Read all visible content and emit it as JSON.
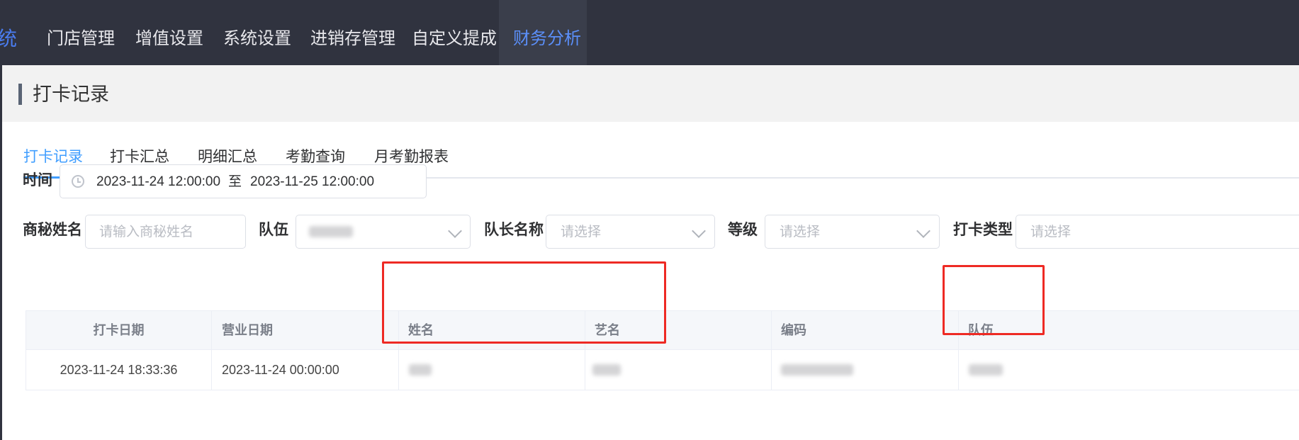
{
  "nav": {
    "brand_partial": "统",
    "items": [
      {
        "label": "门店管理"
      },
      {
        "label": "增值设置"
      },
      {
        "label": "系统设置"
      },
      {
        "label": "进销存管理"
      },
      {
        "label": "自定义提成"
      },
      {
        "label": "财务分析"
      }
    ],
    "active_index": 5
  },
  "page": {
    "title": "打卡记录"
  },
  "tabs": [
    {
      "label": "打卡记录"
    },
    {
      "label": "打卡汇总"
    },
    {
      "label": "明细汇总"
    },
    {
      "label": "考勤查询"
    },
    {
      "label": "月考勤报表"
    }
  ],
  "filters": {
    "time_label": "时间",
    "time_start": "2023-11-24 12:00:00",
    "time_sep": "至",
    "time_end": "2023-11-25 12:00:00",
    "name_label": "商秘姓名",
    "name_placeholder": "请输入商秘姓名",
    "team_label": "队伍",
    "captain_label": "队长名称",
    "captain_placeholder": "请选择",
    "level_label": "等级",
    "level_placeholder": "请选择",
    "punch_type_label": "打卡类型",
    "punch_type_placeholder": "请选择"
  },
  "table": {
    "columns": [
      "打卡日期",
      "营业日期",
      "姓名",
      "艺名",
      "编码",
      "队伍"
    ],
    "rows": [
      {
        "punch_date": "2023-11-24 18:33:36",
        "business_date": "2023-11-24 00:00:00",
        "name": "",
        "stage_name": "",
        "code": "",
        "team": ""
      }
    ]
  },
  "colors": {
    "topbar": "#30333f",
    "accent": "#409eff",
    "highlight": "#ee2a24"
  }
}
